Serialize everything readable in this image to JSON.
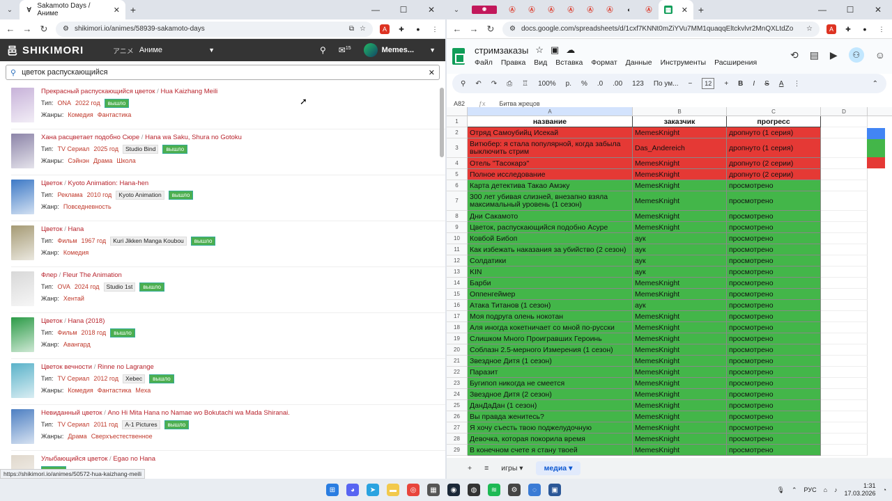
{
  "left": {
    "tab_title": "Sakamoto Days / Аниме",
    "url": "shikimori.io/animes/58939-sakamoto-days",
    "logo": "SHIKIMORI",
    "section_jp": "アニメ",
    "section": "Аниме",
    "username": "Memes...",
    "mail_count": "15",
    "search_value": "цветок распускающийся",
    "status_url": "https://shikimori.io/animes/50572-hua-kaizhang-meili",
    "results": [
      {
        "ru": "Прекрасный распускающийся цветок",
        "en": "Hua Kaizhang Meili",
        "type_label": "Тип:",
        "type": "ONA",
        "year": "2022 год",
        "studio": "",
        "status": "вышло",
        "genre_label": "Жанры:",
        "genres": [
          "Комедия",
          "Фантастика"
        ],
        "color": "#c7b2d9"
      },
      {
        "ru": "Хана расцветает подобно Сюре",
        "en": "Hana wa Saku, Shura no Gotoku",
        "type_label": "Тип:",
        "type": "TV Сериал",
        "year": "2025 год",
        "studio": "Studio Bind",
        "status": "вышло",
        "genre_label": "Жанры:",
        "genres": [
          "Сэйнэн",
          "Драма",
          "Школа"
        ],
        "color": "#8c84a8"
      },
      {
        "ru": "Цветок",
        "en": "Kyoto Animation: Hana-hen",
        "type_label": "Тип:",
        "type": "Реклама",
        "year": "2010 год",
        "studio": "Kyoto Animation",
        "status": "вышло",
        "genre_label": "Жанр:",
        "genres": [
          "Повседневность"
        ],
        "color": "#3d79c6"
      },
      {
        "ru": "Цветок",
        "en": "Hana",
        "type_label": "Тип:",
        "type": "Фильм",
        "year": "1967 год",
        "studio": "Kuri Jikken Manga Koubou",
        "status": "вышло",
        "genre_label": "Жанр:",
        "genres": [
          "Комедия"
        ],
        "color": "#a59a74"
      },
      {
        "ru": "Флер",
        "en": "Fleur The Animation",
        "type_label": "Тип:",
        "type": "OVA",
        "year": "2024 год",
        "studio": "Studio 1st",
        "status": "вышло",
        "genre_label": "Жанр:",
        "genres": [
          "Хентай"
        ],
        "color": "#d8d8d8"
      },
      {
        "ru": "Цветок",
        "en": "Hana (2018)",
        "type_label": "Тип:",
        "type": "Фильм",
        "year": "2018 год",
        "studio": "",
        "status": "вышло",
        "genre_label": "Жанр:",
        "genres": [
          "Авангард"
        ],
        "color": "#2c9b47"
      },
      {
        "ru": "Цветок вечности",
        "en": "Rinne no Lagrange",
        "type_label": "Тип:",
        "type": "TV Сериал",
        "year": "2012 год",
        "studio": "Xebec",
        "status": "вышло",
        "genre_label": "Жанры:",
        "genres": [
          "Комедия",
          "Фантастика",
          "Меха"
        ],
        "color": "#5ab2c9"
      },
      {
        "ru": "Невиданный цветок",
        "en": "Ano Hi Mita Hana no Namae wo Bokutachi wa Mada Shiranai.",
        "type_label": "Тип:",
        "type": "TV Сериал",
        "year": "2011 год",
        "studio": "A-1 Pictures",
        "status": "вышло",
        "genre_label": "Жанры:",
        "genres": [
          "Драма",
          "Сверхъестественное"
        ],
        "color": "#4d7fc2"
      },
      {
        "ru": "Улыбающийся цветок",
        "en": "Egao no Hana",
        "type_label": "",
        "type": "",
        "year": "",
        "studio": "",
        "status": "вышло",
        "genre_label": "",
        "genres": [],
        "color": "#e0d8cc"
      }
    ]
  },
  "right": {
    "tab_title": "Таб",
    "url": "docs.google.com/spreadsheets/d/1cxf7KNNt0mZiYVu7MM1quaqqEltckvlvr2MnQXLtdZo/edi...",
    "doc_title": "стримзаказы",
    "menu": [
      "Файл",
      "Правка",
      "Вид",
      "Вставка",
      "Формат",
      "Данные",
      "Инструменты",
      "Расширения"
    ],
    "zoom": "100%",
    "font": "По ум...",
    "font_size": "12",
    "cell_ref": "A82",
    "formula": "Битва жрецов",
    "cols": [
      "A",
      "B",
      "C",
      "D"
    ],
    "headers": [
      "название",
      "заказчик",
      "прогресс"
    ],
    "rows": [
      {
        "n": "2",
        "a": "Отряд Самоубийц  Исекай",
        "b": "MemesKnight",
        "c": "дропнуто (1 серия)",
        "s": "red",
        "h": 16
      },
      {
        "n": "3",
        "a": "Витюбер: я стала популярной, когда забыла выключить стрим",
        "b": "Das_Andereich",
        "c": "дропнуто (1 серия)",
        "s": "red",
        "h": 28
      },
      {
        "n": "4",
        "a": "Отель \"Тасокарэ\"",
        "b": "MemesKnight",
        "c": "дропнуто (2 серии)",
        "s": "red",
        "h": 16
      },
      {
        "n": "5",
        "a": "Полное исследование",
        "b": "MemesKnight",
        "c": "дропнуто (2 серии)",
        "s": "red",
        "h": 16
      },
      {
        "n": "6",
        "a": "Карта детектива Такао Амэку",
        "b": "MemesKnight",
        "c": "просмотрено",
        "s": "green",
        "h": 16
      },
      {
        "n": "7",
        "a": "300 лет убивая слизней, внезапно взяла максимальный уровень (1 сезон)",
        "b": "MemesKnight",
        "c": "просмотрено",
        "s": "green",
        "h": 28
      },
      {
        "n": "8",
        "a": "Дни Сакамото",
        "b": "MemesKnight",
        "c": "просмотрено",
        "s": "green",
        "h": 16
      },
      {
        "n": "9",
        "a": "Цветок, распускающийся подобно Асуре",
        "b": "MemesKnight",
        "c": "просмотрено",
        "s": "green",
        "h": 16
      },
      {
        "n": "10",
        "a": "Ковбой Бибоп",
        "b": "аук",
        "c": "просмотрено",
        "s": "green",
        "h": 16
      },
      {
        "n": "11",
        "a": "Как избежать наказания за убийство (2 сезон)",
        "b": "аук",
        "c": "просмотрено",
        "s": "green",
        "h": 16
      },
      {
        "n": "12",
        "a": "Солдатики",
        "b": "аук",
        "c": "просмотрено",
        "s": "green",
        "h": 16
      },
      {
        "n": "13",
        "a": "KIN",
        "b": "аук",
        "c": "просмотрено",
        "s": "green",
        "h": 16
      },
      {
        "n": "14",
        "a": "Барби",
        "b": "MemesKnight",
        "c": "просмотрено",
        "s": "green",
        "h": 16
      },
      {
        "n": "15",
        "a": "Оппенгеймер",
        "b": "MemesKnight",
        "c": "просмотрено",
        "s": "green",
        "h": 16
      },
      {
        "n": "16",
        "a": "Атака Титанов (1 сезон)",
        "b": "аук",
        "c": "просмотрено",
        "s": "green",
        "h": 16
      },
      {
        "n": "17",
        "a": "Моя подруга олень нокотан",
        "b": "MemesKnight",
        "c": "просмотрено",
        "s": "green",
        "h": 16
      },
      {
        "n": "18",
        "a": "Аля иногда кокетничает со мной по-русски",
        "b": "MemesKnight",
        "c": "просмотрено",
        "s": "green",
        "h": 16
      },
      {
        "n": "19",
        "a": "Слишком Много Проигравших Героинь",
        "b": "MemesKnight",
        "c": "просмотрено",
        "s": "green",
        "h": 16
      },
      {
        "n": "20",
        "a": "Соблазн 2.5-мерного Измерения (1 сезон)",
        "b": "MemesKnight",
        "c": "просмотрено",
        "s": "green",
        "h": 16
      },
      {
        "n": "21",
        "a": "Звездное Дитя (1 сезон)",
        "b": "MemesKnight",
        "c": "просмотрено",
        "s": "green",
        "h": 16
      },
      {
        "n": "22",
        "a": "Паразит",
        "b": "MemesKnight",
        "c": "просмотрено",
        "s": "green",
        "h": 16
      },
      {
        "n": "23",
        "a": "Бугипоп никогда не смеется",
        "b": "MemesKnight",
        "c": "просмотрено",
        "s": "green",
        "h": 16
      },
      {
        "n": "24",
        "a": "Звездное Дитя (2 сезон)",
        "b": "MemesKnight",
        "c": "просмотрено",
        "s": "green",
        "h": 16
      },
      {
        "n": "25",
        "a": "ДанДаДан (1 сезон)",
        "b": "MemesKnight",
        "c": "просмотрено",
        "s": "green",
        "h": 16
      },
      {
        "n": "26",
        "a": "Вы правда женитесь?",
        "b": "MemesKnight",
        "c": "просмотрено",
        "s": "green",
        "h": 16
      },
      {
        "n": "27",
        "a": "Я хочу съесть твою поджелудочную",
        "b": "MemesKnight",
        "c": "просмотрено",
        "s": "green",
        "h": 16
      },
      {
        "n": "28",
        "a": "Девочка, которая покорила время",
        "b": "MemesKnight",
        "c": "просмотрено",
        "s": "green",
        "h": 16
      },
      {
        "n": "29",
        "a": "В конечном счете я стану твоей",
        "b": "MemesKnight",
        "c": "просмотрено",
        "s": "green",
        "h": 16
      }
    ],
    "sheet_tabs": [
      "игры",
      "медиа"
    ]
  },
  "taskbar": {
    "lang": "РУС",
    "time": "1:31",
    "date": "17.03.2026"
  },
  "colors": {
    "red": "#e53935",
    "green": "#43b649",
    "link": "#b8232c"
  }
}
